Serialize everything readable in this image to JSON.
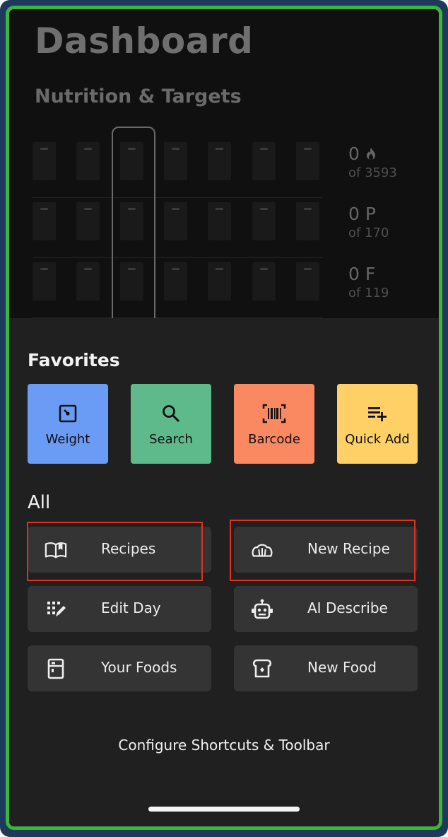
{
  "dashboard": {
    "title": "Dashboard",
    "subtitle": "Nutrition & Targets",
    "targets": [
      {
        "value": "0",
        "icon": "flame-icon",
        "of": "of 3593"
      },
      {
        "value": "0 P",
        "of": "of 170"
      },
      {
        "value": "0 F",
        "of": "of 119"
      }
    ]
  },
  "favorites": {
    "title": "Favorites",
    "items": [
      {
        "label": "Weight",
        "icon": "scale-icon",
        "color": "#6a9cf6"
      },
      {
        "label": "Search",
        "icon": "search-icon",
        "color": "#5eb98b"
      },
      {
        "label": "Barcode",
        "icon": "barcode-icon",
        "color": "#fa8861"
      },
      {
        "label": "Quick Add",
        "icon": "quick-add-icon",
        "color": "#fed066"
      }
    ]
  },
  "all": {
    "title": "All",
    "items": [
      {
        "label": "Recipes",
        "icon": "book-icon"
      },
      {
        "label": "New Recipe",
        "icon": "chef-hat-icon"
      },
      {
        "label": "Edit Day",
        "icon": "edit-day-icon"
      },
      {
        "label": "AI Describe",
        "icon": "robot-icon"
      },
      {
        "label": "Your Foods",
        "icon": "foods-list-icon"
      },
      {
        "label": "New Food",
        "icon": "new-food-icon"
      }
    ]
  },
  "config_label": "Configure Shortcuts & Toolbar",
  "colors": {
    "highlight_border": "#e0311f",
    "frame_border": "#3bb53b"
  }
}
